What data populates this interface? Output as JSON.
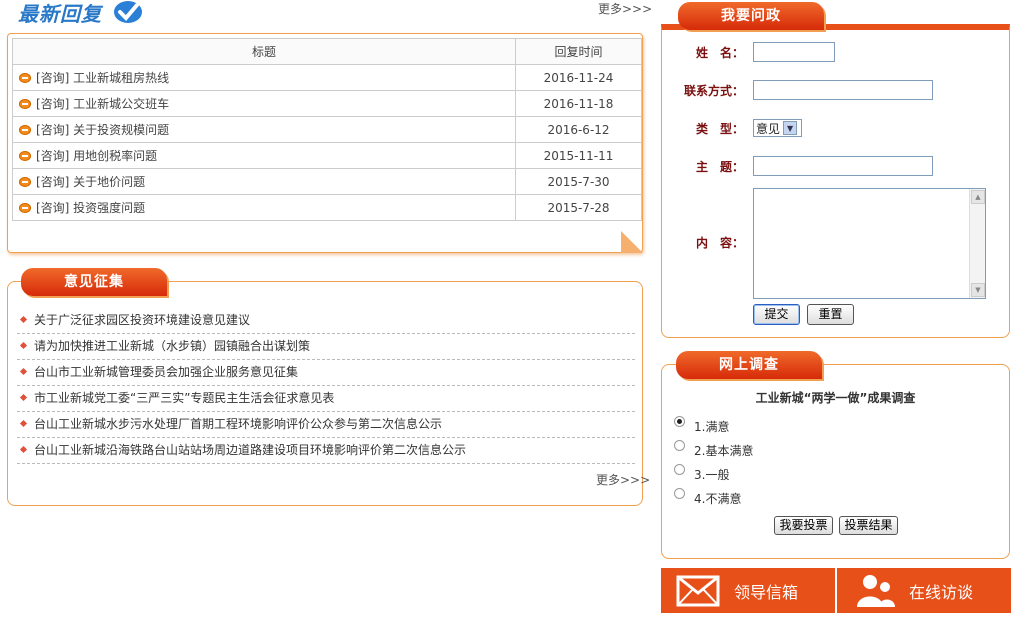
{
  "latest": {
    "title": "最新回复",
    "more": "更多>>>",
    "columns": [
      "标题",
      "回复时间"
    ],
    "rows": [
      {
        "title": "[咨询] 工业新城租房热线",
        "date": "2016-11-24"
      },
      {
        "title": "[咨询] 工业新城公交班车",
        "date": "2016-11-18"
      },
      {
        "title": "[咨询] 关于投资规模问题",
        "date": "2016-6-12"
      },
      {
        "title": "[咨询] 用地创税率问题",
        "date": "2015-11-11"
      },
      {
        "title": "[咨询] 关于地价问题",
        "date": "2015-7-30"
      },
      {
        "title": "[咨询] 投资强度问题",
        "date": "2015-7-28"
      }
    ]
  },
  "opinion": {
    "title": "意见征集",
    "more": "更多>>>",
    "items": [
      "关于广泛征求园区投资环境建设意见建议",
      "请为加快推进工业新城（水步镇）园镇融合出谋划策",
      "台山市工业新城管理委员会加强企业服务意见征集",
      "市工业新城党工委“三严三实”专题民主生活会征求意见表",
      "台山工业新城水步污水处理厂首期工程环境影响评价公众参与第二次信息公示",
      "台山工业新城沿海铁路台山站站场周边道路建设项目环境影响评价第二次信息公示"
    ]
  },
  "ask": {
    "title": "我要问政",
    "name_label": "姓　名：",
    "contact_label": "联系方式：",
    "type_label": "类　型：",
    "type_value": "意见",
    "subject_label": "主　题：",
    "content_label": "内　容：",
    "submit": "提交",
    "reset": "重置"
  },
  "survey": {
    "title": "网上调查",
    "question": "工业新城“两学一做”成果调查",
    "options": [
      "1.满意",
      "2.基本满意",
      "3.一般",
      "4.不满意"
    ],
    "selected": 0,
    "vote": "我要投票",
    "results": "投票结果"
  },
  "bottom": {
    "mailbox": "领导信箱",
    "interview": "在线访谈"
  },
  "colors": {
    "accent": "#e8501a",
    "border": "#f0a050",
    "label": "#7a1010"
  }
}
